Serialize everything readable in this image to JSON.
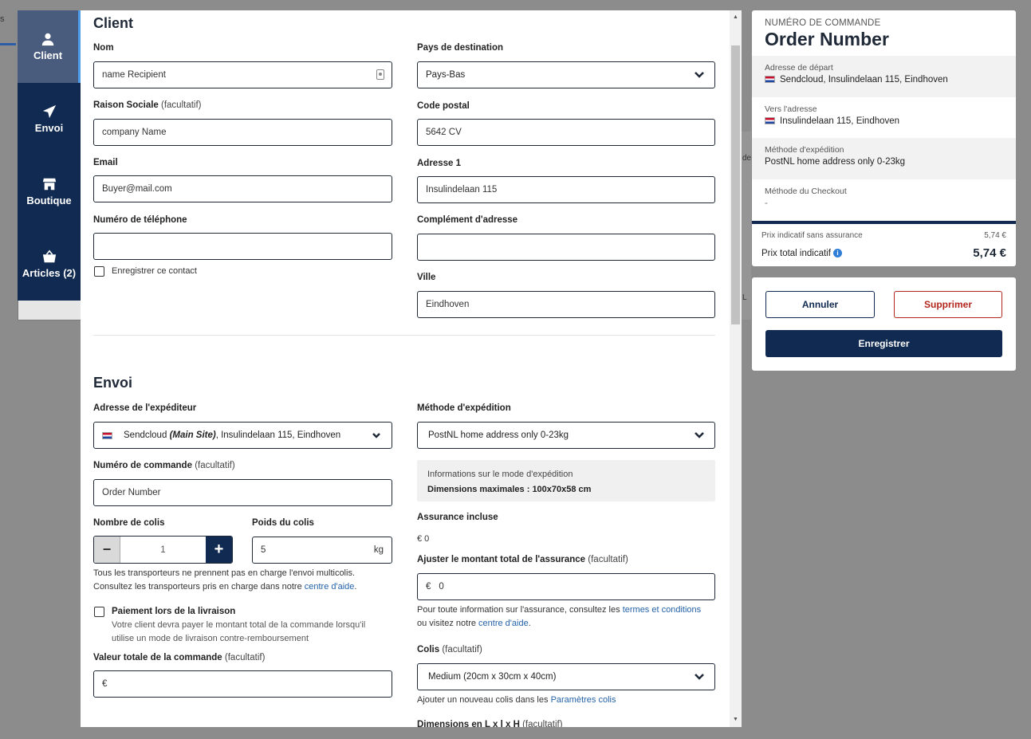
{
  "background": {
    "tab_fragment": "s",
    "fragment_1": "de",
    "fragment_2": "L"
  },
  "nav": {
    "items": [
      {
        "label": "Client",
        "icon": "user-icon"
      },
      {
        "label": "Envoi",
        "icon": "send-icon"
      },
      {
        "label": "Boutique",
        "icon": "shop-icon"
      },
      {
        "label": "Articles (2)",
        "icon": "basket-icon"
      }
    ]
  },
  "client": {
    "title": "Client",
    "nom_label": "Nom",
    "nom_placeholder": "name Recipient",
    "raison_label": "Raison Sociale",
    "raison_optional": "(facultatif)",
    "raison_placeholder": "company Name",
    "email_label": "Email",
    "email_placeholder": "Buyer@mail.com",
    "phone_label": "Numéro de téléphone",
    "phone_value": "",
    "save_contact_label": "Enregistrer ce contact",
    "pays_label": "Pays de destination",
    "pays_value": "Pays-Bas",
    "code_postal_label": "Code postal",
    "code_postal_value": "5642 CV",
    "adresse1_label": "Adresse 1",
    "adresse1_value": "Insulindelaan 115",
    "complement_label": "Complément d'adresse",
    "complement_value": "",
    "ville_label": "Ville",
    "ville_value": "Eindhoven"
  },
  "envoi": {
    "title": "Envoi",
    "expediteur_label": "Adresse de l'expéditeur",
    "expediteur_name": "Sendcloud",
    "expediteur_site": "(Main Site)",
    "expediteur_addr": ", Insulindelaan 115, Eindhoven",
    "commande_label": "Numéro de commande",
    "commande_optional": "(facultatif)",
    "commande_placeholder": "Order Number",
    "colis_count_label": "Nombre de colis",
    "colis_count_value": "1",
    "poids_label": "Poids du colis",
    "poids_value": "5",
    "poids_unit": "kg",
    "multicolis_text": "Tous les transporteurs ne prennent pas en charge l'envoi multicolis.",
    "multicolis_text2": "Consultez les transporteurs pris en charge dans notre ",
    "help_link": "centre d'aide",
    "cod_label": "Paiement lors de la livraison",
    "cod_desc1": "Votre client devra payer le montant total de la commande lorsqu'il",
    "cod_desc2": "utilise un mode de livraison contre-remboursement",
    "valeur_label": "Valeur totale de la commande",
    "valeur_optional": "(facultatif)",
    "valeur_prefix": "€",
    "methode_label": "Méthode d'expédition",
    "methode_value": "PostNL home address only 0-23kg",
    "info_title": "Informations sur le mode d'expédition",
    "info_dims": "Dimensions maximales : 100x70x58 cm",
    "assurance_label": "Assurance incluse",
    "assurance_value": "€ 0",
    "ajuster_label": "Ajuster le montant total de l'assurance",
    "ajuster_optional": "(facultatif)",
    "ajuster_prefix": "€",
    "ajuster_value": "0",
    "assurance_info1": "Pour toute information sur l'assurance, consultez les ",
    "termes_link": "termes et conditions",
    "assurance_info2": "ou visitez notre ",
    "help_link2": "centre d'aide",
    "colis_label": "Colis",
    "colis_optional": "(facultatif)",
    "colis_value": "Medium (20cm x 30cm x 40cm)",
    "colis_add_text": "Ajouter un nouveau colis dans les ",
    "colis_link": "Paramètres colis",
    "dims_label": "Dimensions en L x l x H",
    "dims_optional": "(facultatif)"
  },
  "summary": {
    "order_key": "NUMÉRO DE COMMANDE",
    "order_value": "Order Number",
    "depart_key": "Adresse de départ",
    "depart_value": "Sendcloud, Insulindelaan 115, Eindhoven",
    "vers_key": "Vers l'adresse",
    "vers_value": "Insulindelaan 115, Eindhoven",
    "methode_key": "Méthode d'expédition",
    "methode_value": "PostNL home address only 0-23kg",
    "checkout_key": "Méthode du Checkout",
    "checkout_value": "-",
    "prix_sans_label": "Prix indicatif sans assurance",
    "prix_sans_value": "5,74 €",
    "prix_total_label": "Prix total indicatif",
    "prix_total_value": "5,74 €"
  },
  "actions": {
    "cancel": "Annuler",
    "delete": "Supprimer",
    "save": "Enregistrer"
  },
  "colors": {
    "navy": "#102a51",
    "danger": "#b3261e",
    "link": "#2563a8",
    "active_border": "#4c9be8"
  }
}
